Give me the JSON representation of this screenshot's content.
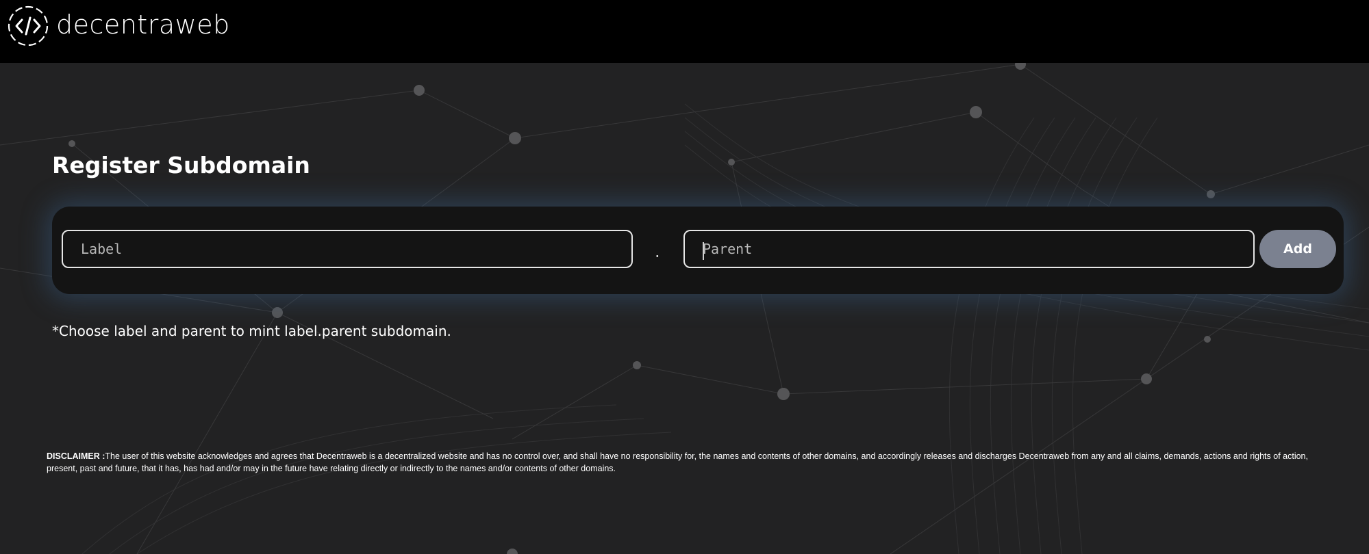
{
  "header": {
    "brand_name": "decentraweb",
    "logo_icon": "code-brackets-icon"
  },
  "main": {
    "title": "Register Subdomain",
    "form": {
      "label_placeholder": "Label",
      "separator": ".",
      "parent_placeholder": "Parent",
      "add_label": "Add"
    },
    "hint": "*Choose label and parent to mint label.parent subdomain."
  },
  "footer": {
    "disclaimer_heading": "DISCLAIMER :",
    "disclaimer_text": "The user of this website acknowledges and agrees that Decentraweb is a decentralized website and has no control over, and shall have no responsibility for, the names and contents of other domains, and accordingly releases and discharges Decentraweb from any and all claims, demands, actions and rights of action, present, past and future, that it has, has had and/or may in the future have relating directly or indirectly to the names and/or contents of other domains."
  },
  "colors": {
    "header_bg": "#000000",
    "page_bg": "#222223",
    "panel_bg": "#141414",
    "panel_glow": "#3a628c",
    "button_bg": "#7b8190",
    "text": "#ffffff"
  }
}
